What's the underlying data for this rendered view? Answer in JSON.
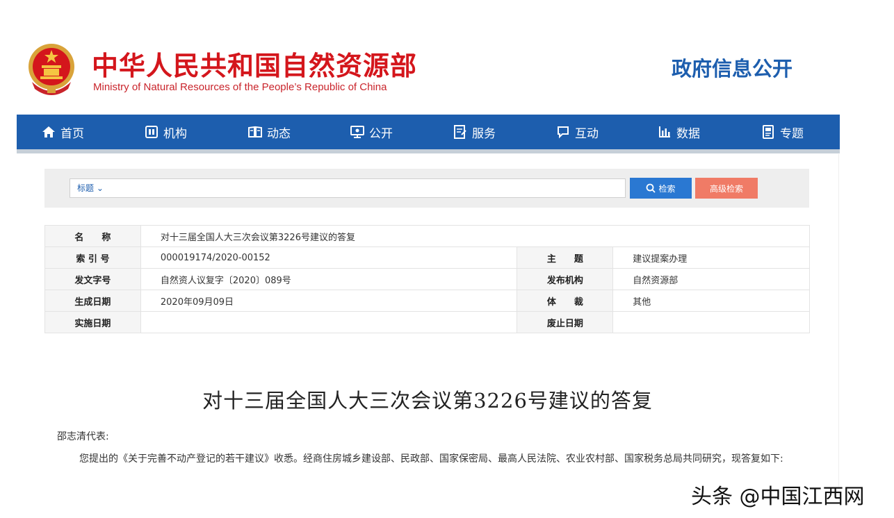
{
  "header": {
    "site_name": "中华人民共和国自然资源部",
    "site_name_en": "Ministry of Natural Resources of the People’s Republic of China",
    "gov_info": "政府信息公开"
  },
  "nav": {
    "items": [
      {
        "label": "首页",
        "icon": "home-icon"
      },
      {
        "label": "机构",
        "icon": "org-icon"
      },
      {
        "label": "动态",
        "icon": "news-icon"
      },
      {
        "label": "公开",
        "icon": "disclosure-icon"
      },
      {
        "label": "服务",
        "icon": "service-icon"
      },
      {
        "label": "互动",
        "icon": "chat-icon"
      },
      {
        "label": "数据",
        "icon": "chart-icon"
      },
      {
        "label": "专题",
        "icon": "topic-icon"
      }
    ]
  },
  "search": {
    "field_label": "标题",
    "value": "",
    "search_label": "检索",
    "advanced_label": "高级检索"
  },
  "meta": {
    "name_label": "名　　称",
    "name_value": "对十三届全国人大三次会议第3226号建议的答复",
    "index_label": "索 引 号",
    "index_value": "000019174/2020-00152",
    "topic_label": "主　　题",
    "topic_value": "建议提案办理",
    "docno_label": "发文字号",
    "docno_value": "自然资人议复字〔2020〕089号",
    "issuer_label": "发布机构",
    "issuer_value": "自然资源部",
    "created_label": "生成日期",
    "created_value": "2020年09月09日",
    "genre_label": "体　　裁",
    "genre_value": "其他",
    "effective_label": "实施日期",
    "effective_value": "",
    "expire_label": "废止日期",
    "expire_value": ""
  },
  "article": {
    "title": "对十三届全国人大三次会议第3226号建议的答复",
    "salutation": "邵志清代表:",
    "paragraph": "您提出的《关于完善不动产登记的若干建议》收悉。经商住房城乡建设部、民政部、国家保密局、最高人民法院、农业农村部、国家税务总局共同研究，现答复如下:"
  },
  "watermark": "头条 @中国江西网",
  "colors": {
    "brand_red": "#d4161c",
    "nav_blue": "#1d5eae",
    "search_blue": "#2a78d2",
    "advanced_red": "#f07b66"
  }
}
